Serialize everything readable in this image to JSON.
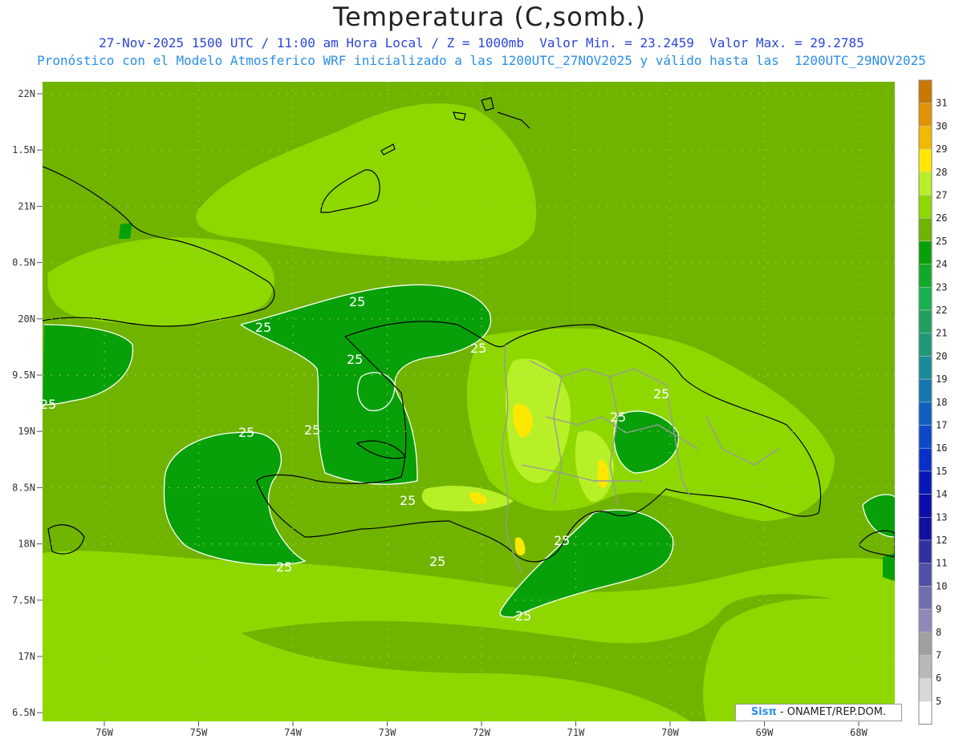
{
  "header": {
    "title": "Temperatura (C,somb.)",
    "line1": "27-Nov-2025 1500 UTC / 11:00 am Hora Local / Z = 1000mb  Valor Min. = 23.2459  Valor Max. = 29.2785",
    "line2": "Pronóstico con el Modelo Atmosferico WRF inicializado a las 1200UTC_27NOV2025 y válido hasta las  1200UTC_29NOV2025"
  },
  "axes": {
    "lat_labels": [
      "22N",
      "1.5N",
      "21N",
      "0.5N",
      "20N",
      "9.5N",
      "19N",
      "8.5N",
      "18N",
      "7.5N",
      "17N",
      "6.5N"
    ],
    "lon_labels": [
      "76W",
      "75W",
      "74W",
      "73W",
      "72W",
      "71W",
      "70W",
      "69W",
      "68W"
    ]
  },
  "colorbar": {
    "labels": [
      "31",
      "30",
      "29",
      "28",
      "27",
      "26",
      "25",
      "24",
      "23",
      "22",
      "21",
      "20",
      "19",
      "18",
      "17",
      "16",
      "15",
      "14",
      "13",
      "12",
      "11",
      "10",
      "9",
      "8",
      "7",
      "6",
      "5"
    ],
    "colors": [
      "#c87800",
      "#e09400",
      "#f0b800",
      "#ffe800",
      "#b8f028",
      "#8ed800",
      "#6eb400",
      "#08a008",
      "#10aa28",
      "#18b050",
      "#20a060",
      "#209878",
      "#188c98",
      "#1478b0",
      "#1060c0",
      "#0c48c8",
      "#0830c8",
      "#0818b8",
      "#0c0ca8",
      "#1010a0",
      "#3030a0",
      "#5050a8",
      "#7070b0",
      "#9088b8",
      "#a0a0a0",
      "#b8b8b8",
      "#d8d8d8",
      "#ffffff"
    ]
  },
  "contour_labels": [
    "25",
    "25",
    "25",
    "25",
    "25",
    "25",
    "25",
    "25",
    "25",
    "25",
    "25",
    "25",
    "25",
    "25"
  ],
  "credit": {
    "sis": "Sisπ",
    "org": " - ONAMET/REP.DOM."
  },
  "colors": {
    "base": "#70b400",
    "light": "#8ed800",
    "dark": "#08a008",
    "warm": "#b8f028",
    "hot": "#ffe800",
    "title_blue": "#2b46d8",
    "subtitle_blue": "#2b8fe8"
  }
}
